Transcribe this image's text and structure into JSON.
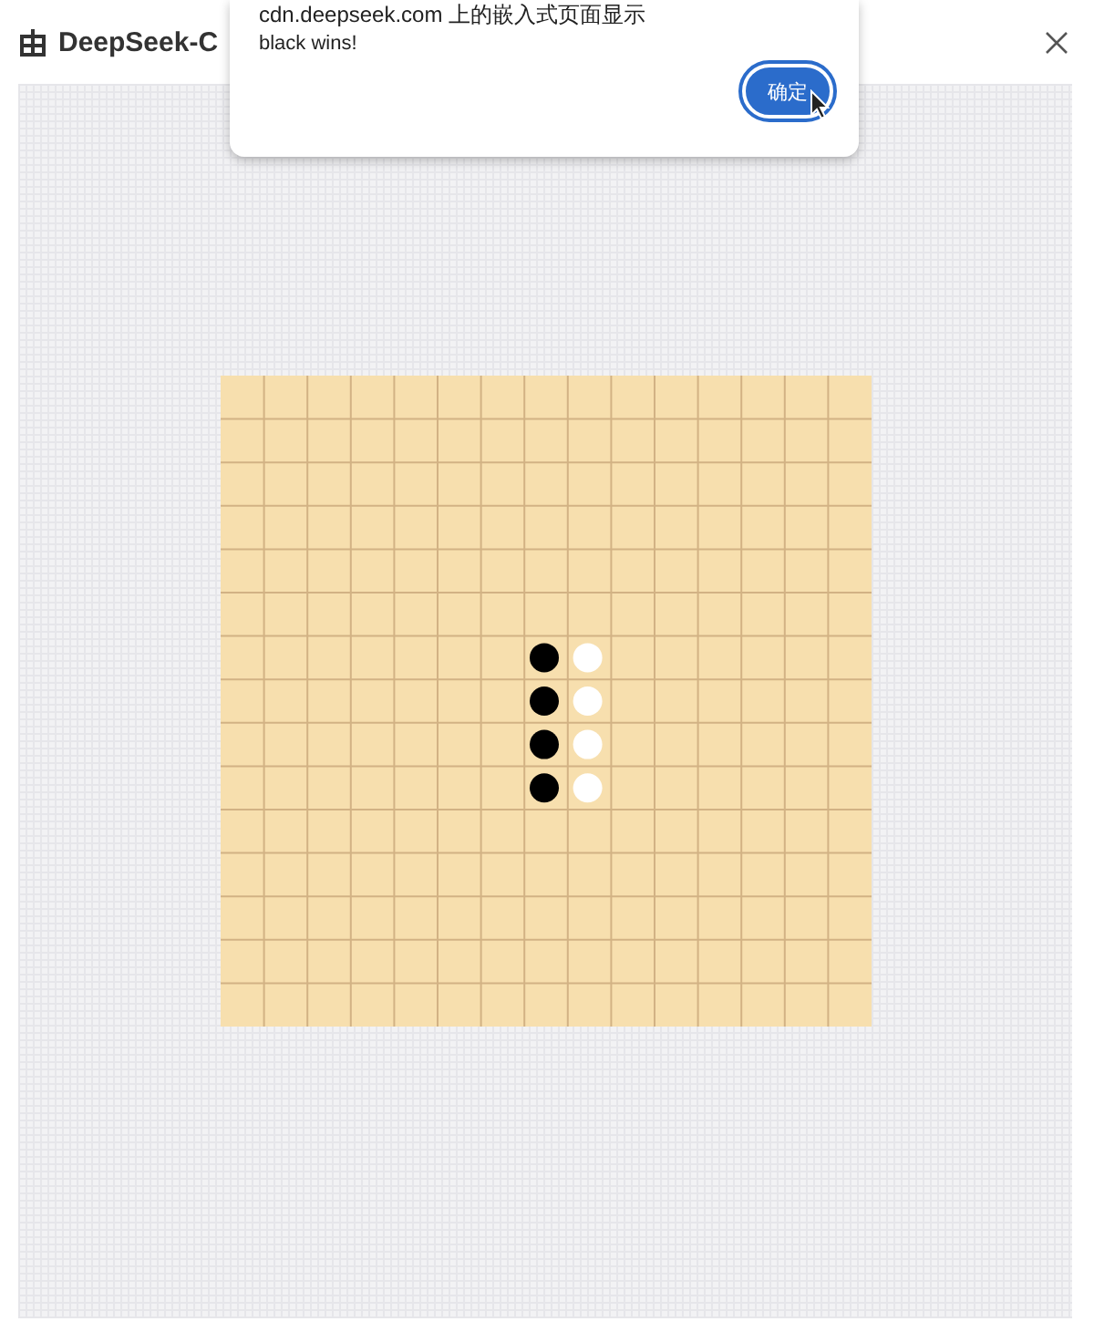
{
  "window": {
    "title": "DeepSeek-C"
  },
  "board": {
    "rows": [
      {
        "cells": [
          {
            "kind": "empty"
          },
          {
            "kind": "empty"
          },
          {
            "kind": "empty"
          },
          {
            "kind": "empty"
          },
          {
            "kind": "empty"
          },
          {
            "kind": "empty"
          },
          {
            "kind": "empty"
          },
          {
            "kind": "empty"
          },
          {
            "kind": "empty"
          },
          {
            "kind": "empty"
          },
          {
            "kind": "empty"
          },
          {
            "kind": "empty"
          },
          {
            "kind": "empty"
          },
          {
            "kind": "empty"
          },
          {
            "kind": "empty"
          }
        ]
      },
      {
        "cells": [
          {
            "kind": "empty"
          },
          {
            "kind": "empty"
          },
          {
            "kind": "empty"
          },
          {
            "kind": "empty"
          },
          {
            "kind": "empty"
          },
          {
            "kind": "empty"
          },
          {
            "kind": "empty"
          },
          {
            "kind": "empty"
          },
          {
            "kind": "empty"
          },
          {
            "kind": "empty"
          },
          {
            "kind": "empty"
          },
          {
            "kind": "empty"
          },
          {
            "kind": "empty"
          },
          {
            "kind": "empty"
          },
          {
            "kind": "empty"
          }
        ]
      },
      {
        "cells": [
          {
            "kind": "empty"
          },
          {
            "kind": "empty"
          },
          {
            "kind": "empty"
          },
          {
            "kind": "empty"
          },
          {
            "kind": "empty"
          },
          {
            "kind": "empty"
          },
          {
            "kind": "empty"
          },
          {
            "kind": "empty"
          },
          {
            "kind": "empty"
          },
          {
            "kind": "empty"
          },
          {
            "kind": "empty"
          },
          {
            "kind": "empty"
          },
          {
            "kind": "empty"
          },
          {
            "kind": "empty"
          },
          {
            "kind": "empty"
          }
        ]
      },
      {
        "cells": [
          {
            "kind": "empty"
          },
          {
            "kind": "empty"
          },
          {
            "kind": "empty"
          },
          {
            "kind": "empty"
          },
          {
            "kind": "empty"
          },
          {
            "kind": "empty"
          },
          {
            "kind": "empty"
          },
          {
            "kind": "empty"
          },
          {
            "kind": "empty"
          },
          {
            "kind": "empty"
          },
          {
            "kind": "empty"
          },
          {
            "kind": "empty"
          },
          {
            "kind": "empty"
          },
          {
            "kind": "empty"
          },
          {
            "kind": "empty"
          }
        ]
      },
      {
        "cells": [
          {
            "kind": "empty"
          },
          {
            "kind": "empty"
          },
          {
            "kind": "empty"
          },
          {
            "kind": "empty"
          },
          {
            "kind": "empty"
          },
          {
            "kind": "empty"
          },
          {
            "kind": "empty"
          },
          {
            "kind": "empty"
          },
          {
            "kind": "empty"
          },
          {
            "kind": "empty"
          },
          {
            "kind": "empty"
          },
          {
            "kind": "empty"
          },
          {
            "kind": "empty"
          },
          {
            "kind": "empty"
          },
          {
            "kind": "empty"
          }
        ]
      },
      {
        "cells": [
          {
            "kind": "empty"
          },
          {
            "kind": "empty"
          },
          {
            "kind": "empty"
          },
          {
            "kind": "empty"
          },
          {
            "kind": "empty"
          },
          {
            "kind": "empty"
          },
          {
            "kind": "empty"
          },
          {
            "kind": "empty"
          },
          {
            "kind": "empty"
          },
          {
            "kind": "empty"
          },
          {
            "kind": "empty"
          },
          {
            "kind": "empty"
          },
          {
            "kind": "empty"
          },
          {
            "kind": "empty"
          },
          {
            "kind": "empty"
          }
        ]
      },
      {
        "cells": [
          {
            "kind": "empty"
          },
          {
            "kind": "empty"
          },
          {
            "kind": "empty"
          },
          {
            "kind": "empty"
          },
          {
            "kind": "empty"
          },
          {
            "kind": "empty"
          },
          {
            "kind": "empty"
          },
          {
            "kind": "black"
          },
          {
            "kind": "white"
          },
          {
            "kind": "empty"
          },
          {
            "kind": "empty"
          },
          {
            "kind": "empty"
          },
          {
            "kind": "empty"
          },
          {
            "kind": "empty"
          },
          {
            "kind": "empty"
          }
        ]
      },
      {
        "cells": [
          {
            "kind": "empty"
          },
          {
            "kind": "empty"
          },
          {
            "kind": "empty"
          },
          {
            "kind": "empty"
          },
          {
            "kind": "empty"
          },
          {
            "kind": "empty"
          },
          {
            "kind": "empty"
          },
          {
            "kind": "black"
          },
          {
            "kind": "white"
          },
          {
            "kind": "empty"
          },
          {
            "kind": "empty"
          },
          {
            "kind": "empty"
          },
          {
            "kind": "empty"
          },
          {
            "kind": "empty"
          },
          {
            "kind": "empty"
          }
        ]
      },
      {
        "cells": [
          {
            "kind": "empty"
          },
          {
            "kind": "empty"
          },
          {
            "kind": "empty"
          },
          {
            "kind": "empty"
          },
          {
            "kind": "empty"
          },
          {
            "kind": "empty"
          },
          {
            "kind": "empty"
          },
          {
            "kind": "black"
          },
          {
            "kind": "white"
          },
          {
            "kind": "empty"
          },
          {
            "kind": "empty"
          },
          {
            "kind": "empty"
          },
          {
            "kind": "empty"
          },
          {
            "kind": "empty"
          },
          {
            "kind": "empty"
          }
        ]
      },
      {
        "cells": [
          {
            "kind": "empty"
          },
          {
            "kind": "empty"
          },
          {
            "kind": "empty"
          },
          {
            "kind": "empty"
          },
          {
            "kind": "empty"
          },
          {
            "kind": "empty"
          },
          {
            "kind": "empty"
          },
          {
            "kind": "black"
          },
          {
            "kind": "white"
          },
          {
            "kind": "empty"
          },
          {
            "kind": "empty"
          },
          {
            "kind": "empty"
          },
          {
            "kind": "empty"
          },
          {
            "kind": "empty"
          },
          {
            "kind": "empty"
          }
        ]
      },
      {
        "cells": [
          {
            "kind": "empty"
          },
          {
            "kind": "empty"
          },
          {
            "kind": "empty"
          },
          {
            "kind": "empty"
          },
          {
            "kind": "empty"
          },
          {
            "kind": "empty"
          },
          {
            "kind": "empty"
          },
          {
            "kind": "empty"
          },
          {
            "kind": "empty"
          },
          {
            "kind": "empty"
          },
          {
            "kind": "empty"
          },
          {
            "kind": "empty"
          },
          {
            "kind": "empty"
          },
          {
            "kind": "empty"
          },
          {
            "kind": "empty"
          }
        ]
      },
      {
        "cells": [
          {
            "kind": "empty"
          },
          {
            "kind": "empty"
          },
          {
            "kind": "empty"
          },
          {
            "kind": "empty"
          },
          {
            "kind": "empty"
          },
          {
            "kind": "empty"
          },
          {
            "kind": "empty"
          },
          {
            "kind": "empty"
          },
          {
            "kind": "empty"
          },
          {
            "kind": "empty"
          },
          {
            "kind": "empty"
          },
          {
            "kind": "empty"
          },
          {
            "kind": "empty"
          },
          {
            "kind": "empty"
          },
          {
            "kind": "empty"
          }
        ]
      },
      {
        "cells": [
          {
            "kind": "empty"
          },
          {
            "kind": "empty"
          },
          {
            "kind": "empty"
          },
          {
            "kind": "empty"
          },
          {
            "kind": "empty"
          },
          {
            "kind": "empty"
          },
          {
            "kind": "empty"
          },
          {
            "kind": "empty"
          },
          {
            "kind": "empty"
          },
          {
            "kind": "empty"
          },
          {
            "kind": "empty"
          },
          {
            "kind": "empty"
          },
          {
            "kind": "empty"
          },
          {
            "kind": "empty"
          },
          {
            "kind": "empty"
          }
        ]
      },
      {
        "cells": [
          {
            "kind": "empty"
          },
          {
            "kind": "empty"
          },
          {
            "kind": "empty"
          },
          {
            "kind": "empty"
          },
          {
            "kind": "empty"
          },
          {
            "kind": "empty"
          },
          {
            "kind": "empty"
          },
          {
            "kind": "empty"
          },
          {
            "kind": "empty"
          },
          {
            "kind": "empty"
          },
          {
            "kind": "empty"
          },
          {
            "kind": "empty"
          },
          {
            "kind": "empty"
          },
          {
            "kind": "empty"
          },
          {
            "kind": "empty"
          }
        ]
      },
      {
        "cells": [
          {
            "kind": "empty"
          },
          {
            "kind": "empty"
          },
          {
            "kind": "empty"
          },
          {
            "kind": "empty"
          },
          {
            "kind": "empty"
          },
          {
            "kind": "empty"
          },
          {
            "kind": "empty"
          },
          {
            "kind": "empty"
          },
          {
            "kind": "empty"
          },
          {
            "kind": "empty"
          },
          {
            "kind": "empty"
          },
          {
            "kind": "empty"
          },
          {
            "kind": "empty"
          },
          {
            "kind": "empty"
          },
          {
            "kind": "empty"
          }
        ]
      }
    ]
  },
  "dialog": {
    "origin": "cdn.deepseek.com 上的嵌入式页面显示",
    "message": "black wins!",
    "button": "确定"
  }
}
